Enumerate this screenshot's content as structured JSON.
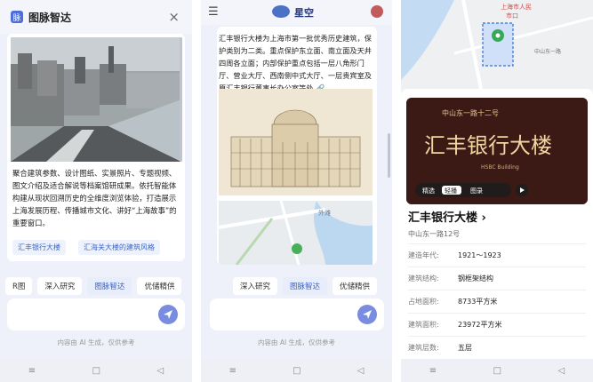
{
  "panel1": {
    "logo_char": "脉",
    "title": "图脉智达",
    "close_icon": "×",
    "description": "聚合建筑参数、设计图纸、实景照片、专题视频、图文介绍及适合解说等档案馆研成果。依托智能体构建从现状回溯历史的全维度浏览体验，打造展示上海发展历程、传播城市文化、讲好“上海故事”的重要窗口。",
    "links": [
      "汇丰银行大楼",
      "汇海关大楼的建筑风格"
    ],
    "chips": [
      "R图",
      "深入研究",
      "图脉智达",
      "优储精供"
    ],
    "active_chip": 2,
    "note": "内容由 AI 生成，仅供参考",
    "nav": [
      "≡",
      "□",
      "◁"
    ]
  },
  "panel2": {
    "menu_icon": "☰",
    "title": "星空",
    "description": "汇丰银行大楼为上海市第一批优秀历史建筑，保护类别为二类。重点保护东立面、南立面及天井四周各立面；内部保护重点包括一层八角形门厅、营业大厅、西南侧中式大厅、一层贵宾室及原汇丰银行董事长办公室等处 🔗。",
    "map_label": "外滩",
    "chips": [
      "深入研究",
      "图脉智达",
      "优储精供"
    ],
    "active_chip": 1,
    "note": "内容由 AI 生成，仅供参考",
    "nav": [
      "≡",
      "□",
      "◁"
    ]
  },
  "panel3": {
    "map_labels": [
      "上海市人民",
      "市口",
      "中山东一路"
    ],
    "video_title": "汇丰银行大楼",
    "video_sub": "中山东一路十二号",
    "video_en": "HSBC Building",
    "video_controls": [
      "精选",
      "轻播",
      "图录"
    ],
    "name": "汇丰银行大楼",
    "name_arrow": "›",
    "address": "中山东一路12号",
    "rows": [
      {
        "k": "建造年代:",
        "v": "1921～1923"
      },
      {
        "k": "建筑结构:",
        "v": "钢框架结构"
      },
      {
        "k": "占地面积:",
        "v": "8733平方米"
      },
      {
        "k": "建筑面积:",
        "v": "23972平方米"
      },
      {
        "k": "建筑层数:",
        "v": "五层"
      }
    ],
    "nav": [
      "≡",
      "□",
      "◁"
    ]
  },
  "colors": {
    "accent": "#3b64c9",
    "send": "#7a8ce0"
  }
}
